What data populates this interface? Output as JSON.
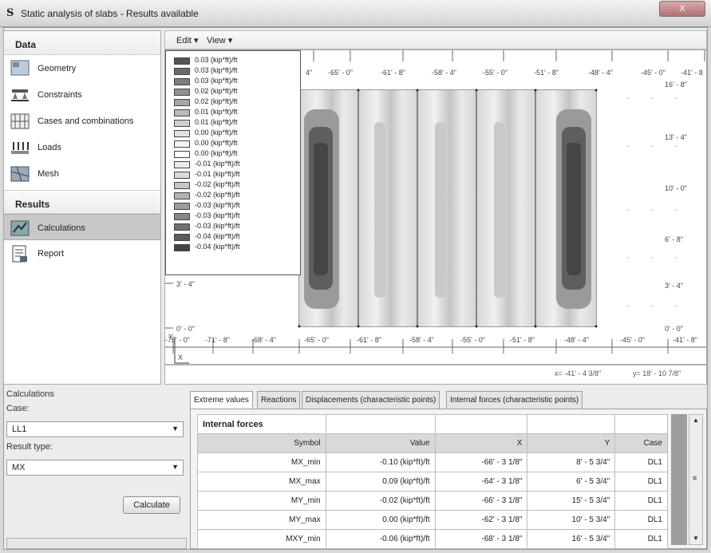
{
  "window": {
    "title": "Static analysis of slabs - Results available",
    "app_icon": "S",
    "close_label": "X"
  },
  "nav": {
    "data_header": "Data",
    "results_header": "Results",
    "items": [
      {
        "label": "Geometry",
        "icon": "geometry-icon"
      },
      {
        "label": "Constraints",
        "icon": "constraints-icon"
      },
      {
        "label": "Cases and combinations",
        "icon": "cases-icon"
      },
      {
        "label": "Loads",
        "icon": "loads-icon"
      },
      {
        "label": "Mesh",
        "icon": "mesh-icon"
      }
    ],
    "result_items": [
      {
        "label": "Calculations",
        "icon": "calculations-icon",
        "active": true
      },
      {
        "label": "Report",
        "icon": "report-icon"
      }
    ]
  },
  "toolbar": {
    "edit": "Edit ▾",
    "view": "View ▾"
  },
  "legend": {
    "items": [
      {
        "label": "0.03 (kip*ft)/ft",
        "color": "#555555"
      },
      {
        "label": "0.03 (kip*ft)/ft",
        "color": "#6a6a6a"
      },
      {
        "label": "0.03 (kip*ft)/ft",
        "color": "#7d7d7d"
      },
      {
        "label": "0.02 (kip*ft)/ft",
        "color": "#919191"
      },
      {
        "label": "0.02 (kip*ft)/ft",
        "color": "#a5a5a5"
      },
      {
        "label": "0.01 (kip*ft)/ft",
        "color": "#bababa"
      },
      {
        "label": "0.01 (kip*ft)/ft",
        "color": "#cfcfcf"
      },
      {
        "label": "0.00 (kip*ft)/ft",
        "color": "#e3e3e3"
      },
      {
        "label": "0.00 (kip*ft)/ft",
        "color": "#f4f4f4"
      },
      {
        "label": "0.00 (kip*ft)/ft",
        "color": "#ffffff"
      },
      {
        "label": "-0.01 (kip*ft)/ft",
        "color": "#ececec"
      },
      {
        "label": "-0.01 (kip*ft)/ft",
        "color": "#dadada"
      },
      {
        "label": "-0.02 (kip*ft)/ft",
        "color": "#c6c6c6"
      },
      {
        "label": "-0.02 (kip*ft)/ft",
        "color": "#b2b2b2"
      },
      {
        "label": "-0.03 (kip*ft)/ft",
        "color": "#9d9d9d"
      },
      {
        "label": "-0.03 (kip*ft)/ft",
        "color": "#878787"
      },
      {
        "label": "-0.03 (kip*ft)/ft",
        "color": "#717171"
      },
      {
        "label": "-0.04 (kip*ft)/ft",
        "color": "#5b5b5b"
      },
      {
        "label": "-0.04 (kip*ft)/ft",
        "color": "#444444"
      }
    ]
  },
  "canvas": {
    "x_ticks": [
      "-75' - 0\"",
      "-71' - 8\"",
      "-68' - 4\"",
      "-65' - 0\"",
      "-61' - 8\"",
      "-58' - 4\"",
      "-55' - 0\"",
      "-51' - 8\"",
      "-48' - 4\"",
      "-45' - 0\"",
      "-41' - 8\""
    ],
    "top_ticks": [
      "4\"",
      "-65' - 0\"",
      "-61' - 8\"",
      "-58' - 4\"",
      "-55' - 0\"",
      "-51' - 8\"",
      "-48' - 4\"",
      "-45' - 0\"",
      "-41' - 8"
    ],
    "y_ticks_right": [
      "16' - 8\"",
      "13' - 4\"",
      "10' - 0\"",
      "6' - 8\"",
      "3' - 4\"",
      "0' - 0\""
    ],
    "y_ticks_left": [
      "3' - 4\"",
      "0' - 0\""
    ],
    "axis_y": "Y",
    "axis_x": "X",
    "coord_x": "x= -41' - 4 3/8\"",
    "coord_y": "y= 18' - 10 7/8\""
  },
  "calc": {
    "title": "Calculations",
    "case_label": "Case:",
    "case_value": "LL1",
    "result_label": "Result type:",
    "result_value": "MX",
    "calculate": "Calculate"
  },
  "tabs": [
    {
      "label": "Extreme values",
      "active": true
    },
    {
      "label": "Reactions"
    },
    {
      "label": "Displacements (characteristic points)"
    },
    {
      "label": "Internal forces (characteristic points)"
    }
  ],
  "table": {
    "caption": "Internal forces",
    "columns": [
      "Symbol",
      "Value",
      "X",
      "Y",
      "Case"
    ],
    "rows": [
      [
        "MX_min",
        "-0.10 (kip*ft)/ft",
        "-66' - 3 1/8\"",
        "8' - 5 3/4\"",
        "DL1"
      ],
      [
        "MX_max",
        "0.09 (kip*ft)/ft",
        "-64' - 3 1/8\"",
        "6' - 5 3/4\"",
        "DL1"
      ],
      [
        "MY_min",
        "-0.02 (kip*ft)/ft",
        "-66' - 3 1/8\"",
        "15' - 5 3/4\"",
        "DL1"
      ],
      [
        "MY_max",
        "0.00 (kip*ft)/ft",
        "-62' - 3 1/8\"",
        "10' - 5 3/4\"",
        "DL1"
      ],
      [
        "MXY_min",
        "-0.06 (kip*ft)/ft",
        "-68' - 3 1/8\"",
        "16' - 5 3/4\"",
        "DL1"
      ]
    ]
  }
}
